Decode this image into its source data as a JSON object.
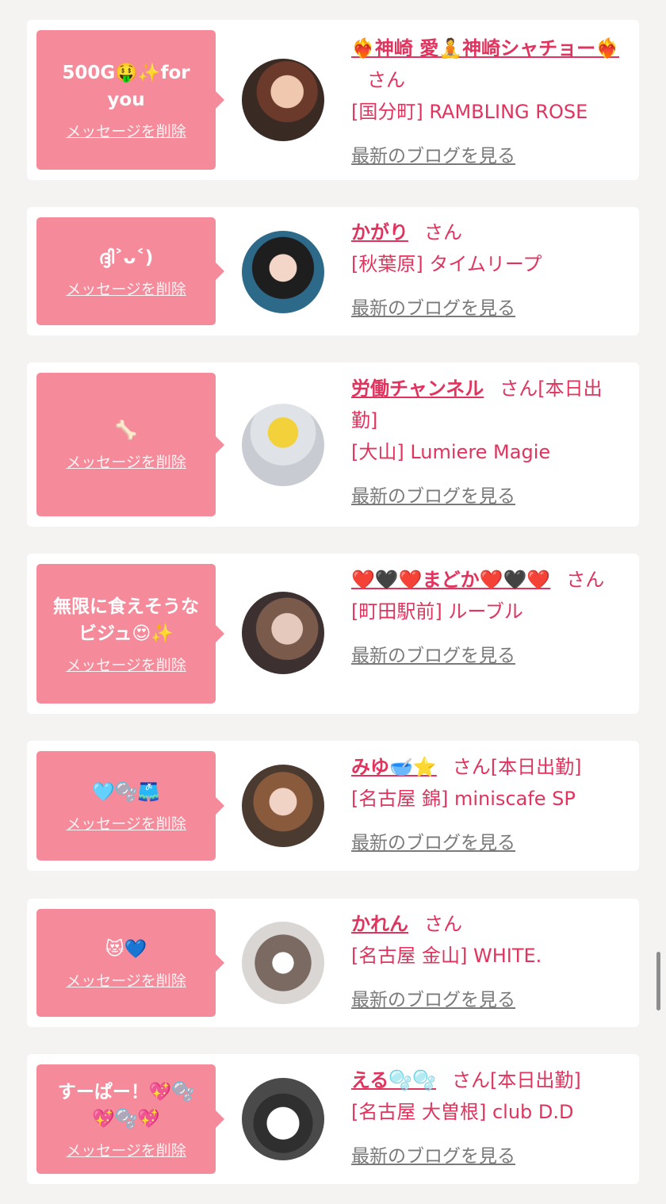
{
  "cards": [
    {
      "message": "500G🤑✨for you",
      "delete_label": "メッセージを削除",
      "name": "❤️‍🔥神崎 愛🧘神崎シャチョー❤️‍🔥",
      "san": "さん",
      "shop": "[国分町] RAMBLING ROSE",
      "blog_label": "最新のブログを見る"
    },
    {
      "message": "ദ്ദി˃ᴗ˂)",
      "delete_label": "メッセージを削除",
      "name": "かがり",
      "san": "さん",
      "shop": "[秋葉原] タイムリープ",
      "blog_label": "最新のブログを見る"
    },
    {
      "message": "🦴",
      "delete_label": "メッセージを削除",
      "name": "労働チャンネル",
      "san": "さん[本日出勤]",
      "shop": "[大山] Lumiere Magie",
      "blog_label": "最新のブログを見る"
    },
    {
      "message": "無限に食えそうなビジュ😍✨",
      "delete_label": "メッセージを削除",
      "name": "❤️🖤❤️まどか❤️🖤❤️",
      "san": "さん",
      "shop": "[町田駅前] ルーブル",
      "blog_label": "最新のブログを見る"
    },
    {
      "message": "🩵🫧🩳",
      "delete_label": "メッセージを削除",
      "name": "みゆ🥣⭐️",
      "san": "さん[本日出勤]",
      "shop": "[名古屋 錦] miniscafe SP",
      "blog_label": "最新のブログを見る"
    },
    {
      "message": "😻💙",
      "delete_label": "メッセージを削除",
      "name": "かれん",
      "san": "さん",
      "shop": "[名古屋 金山] WHITE.",
      "blog_label": "最新のブログを見る"
    },
    {
      "message": "すーぱー！💖🫧💖🫧💖",
      "delete_label": "メッセージを削除",
      "name": "える🫧🫧",
      "san": "さん[本日出勤]",
      "shop": "[名古屋 大曽根] club D.D",
      "blog_label": "最新のブログを見る"
    }
  ],
  "colors": {
    "accent": "#e0345e",
    "bubble": "#f58a9a",
    "background": "#f4f3f2"
  }
}
